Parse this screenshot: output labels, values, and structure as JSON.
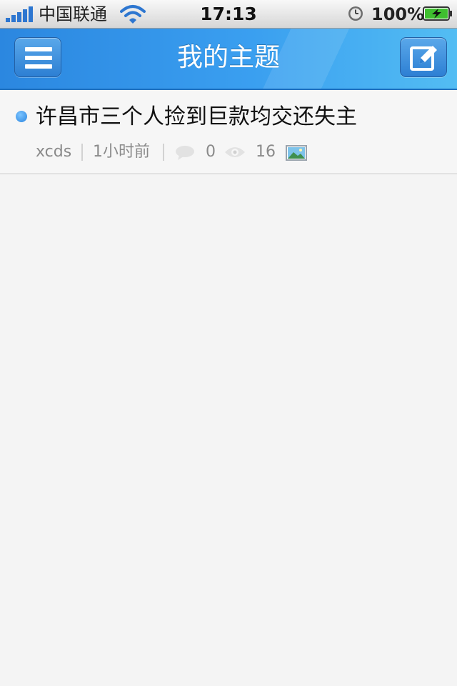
{
  "status_bar": {
    "carrier": "中国联通",
    "time": "17:13",
    "battery_percent": "100%",
    "signal_icon": "signal-bars-icon",
    "wifi_icon": "wifi-icon",
    "alarm_icon": "clock-icon",
    "battery_icon": "battery-charging-icon",
    "battery_level": 1.0
  },
  "nav_bar": {
    "title": "我的主题",
    "left_button_icon": "menu-icon",
    "right_button_icon": "compose-icon"
  },
  "threads": [
    {
      "title": "许昌市三个人捡到巨款均交还失主",
      "author": "xcds",
      "time_ago": "1小时前",
      "replies": "0",
      "views": "16",
      "has_image": true
    }
  ],
  "colors": {
    "nav_gradient_start": "#2b87e0",
    "nav_gradient_end": "#53bdf3",
    "accent": "#2b86e0",
    "background": "#f4f4f4"
  }
}
